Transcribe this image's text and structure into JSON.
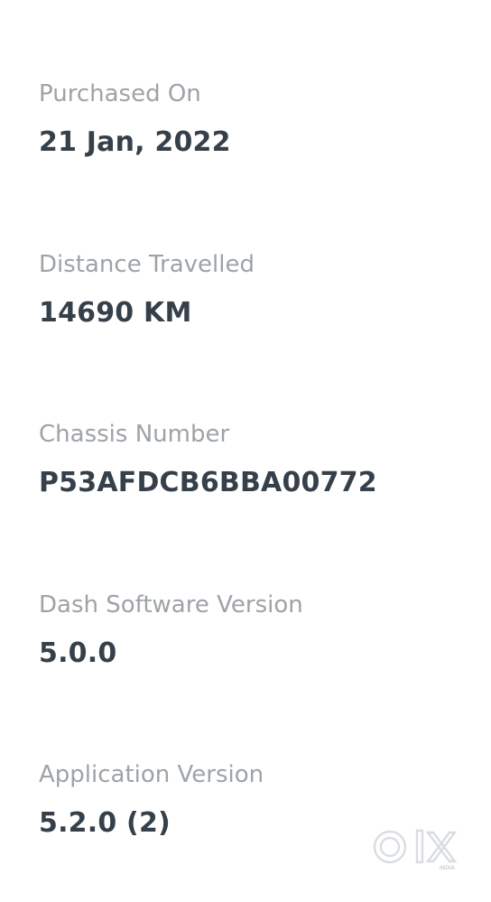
{
  "details": [
    {
      "label": "Purchased On",
      "value": "21 Jan, 2022"
    },
    {
      "label": "Distance Travelled",
      "value": "14690 KM"
    },
    {
      "label": "Chassis Number",
      "value": "P53AFDCB6BBA00772"
    },
    {
      "label": "Dash Software Version",
      "value": "5.0.0"
    },
    {
      "label": "Application Version",
      "value": "5.2.0 (2)"
    }
  ],
  "watermark": {
    "logo": "olx-logo",
    "text": "OLX",
    "subtext": "INDIA"
  }
}
